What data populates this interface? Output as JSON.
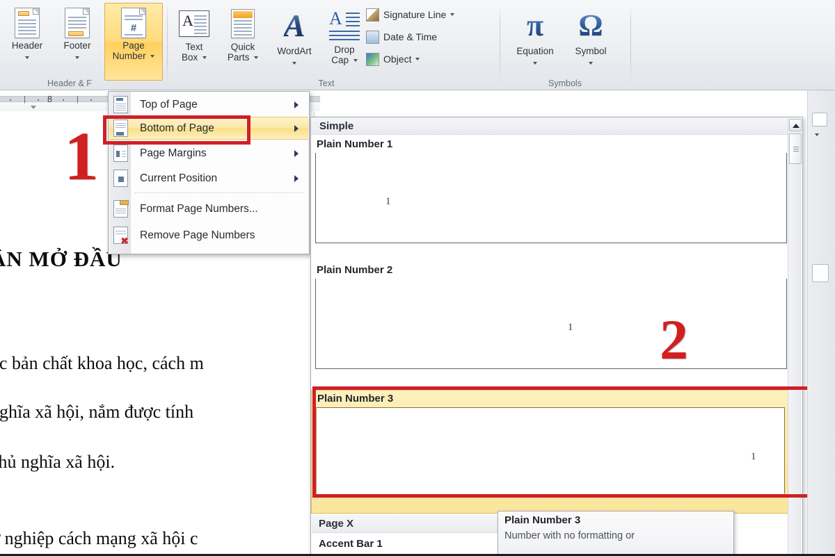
{
  "app": {
    "product": "Microsoft Word 2010",
    "context": "Insert ribbon tab — Page Number dropdown open with Bottom of Page gallery"
  },
  "ribbon": {
    "groups": [
      {
        "name": "Header & Footer",
        "label": "Header & F"
      },
      {
        "name": "Text",
        "label": "Text"
      },
      {
        "name": "Symbols",
        "label": "Symbols"
      }
    ],
    "buttons": [
      {
        "id": "header",
        "line1": "Header",
        "line2": "",
        "icon": "header-doc-icon",
        "has_caret": true,
        "active": false
      },
      {
        "id": "footer",
        "line1": "Footer",
        "line2": "",
        "icon": "footer-doc-icon",
        "has_caret": true,
        "active": false
      },
      {
        "id": "page_number",
        "line1": "Page",
        "line2": "Number",
        "icon": "page-number-doc-icon",
        "has_caret": true,
        "active": true
      },
      {
        "id": "text_box",
        "line1": "Text",
        "line2": "Box",
        "icon": "text-box-icon",
        "has_caret": true,
        "active": false
      },
      {
        "id": "quick_parts",
        "line1": "Quick",
        "line2": "Parts",
        "icon": "quick-parts-icon",
        "has_caret": true,
        "active": false
      },
      {
        "id": "wordart",
        "line1": "WordArt",
        "line2": "",
        "icon": "wordart-icon",
        "has_caret": true,
        "active": false
      },
      {
        "id": "drop_cap",
        "line1": "Drop",
        "line2": "Cap",
        "icon": "drop-cap-icon",
        "has_caret": true,
        "active": false
      },
      {
        "id": "equation",
        "line1": "Equation",
        "line2": "",
        "icon": "pi-icon",
        "glyph": "π",
        "has_caret": true,
        "active": false
      },
      {
        "id": "symbol",
        "line1": "Symbol",
        "line2": "",
        "icon": "omega-icon",
        "glyph": "Ω",
        "has_caret": true,
        "active": false
      }
    ],
    "small_commands": [
      {
        "id": "signature_line",
        "label": "Signature Line",
        "icon": "signature-line-icon",
        "has_caret": true
      },
      {
        "id": "date_time",
        "label": "Date & Time",
        "icon": "date-time-icon",
        "has_caret": false
      },
      {
        "id": "object",
        "label": "Object",
        "icon": "object-icon",
        "has_caret": true
      }
    ]
  },
  "menu": {
    "name": "page-number-menu",
    "items": [
      {
        "id": "top_of_page",
        "label": "Top of Page",
        "accel": "T",
        "submenu": true,
        "selected": false,
        "separator_after": false
      },
      {
        "id": "bottom_of_page",
        "label": "Bottom of Page",
        "accel": "B",
        "submenu": true,
        "selected": true,
        "separator_after": false
      },
      {
        "id": "page_margins",
        "label": "Page Margins",
        "accel": "P",
        "submenu": true,
        "selected": false,
        "separator_after": false
      },
      {
        "id": "current_position",
        "label": "Current Position",
        "accel": "C",
        "submenu": true,
        "selected": false,
        "separator_after": true
      },
      {
        "id": "format_page_numbers",
        "label": "Format Page Numbers...",
        "accel": "F",
        "submenu": false,
        "selected": false,
        "separator_after": false
      },
      {
        "id": "remove_page_numbers",
        "label": "Remove Page Numbers",
        "accel": "R",
        "submenu": false,
        "selected": false,
        "separator_after": false
      }
    ]
  },
  "gallery": {
    "name": "bottom-of-page-gallery",
    "section_header": "Simple",
    "items": [
      {
        "id": "plain_number_1",
        "label": "Plain Number 1",
        "preview_value": "1",
        "align": "left",
        "selected": false
      },
      {
        "id": "plain_number_2",
        "label": "Plain Number 2",
        "preview_value": "1",
        "align": "center",
        "selected": false
      },
      {
        "id": "plain_number_3",
        "label": "Plain Number 3",
        "preview_value": "1",
        "align": "right",
        "selected": true
      }
    ],
    "footer_section_header": "Page X",
    "footer_item": "Accent Bar 1",
    "scrollbar": {
      "up_arrow": "▲",
      "thumb_visible": true
    }
  },
  "tooltip": {
    "name": "gallery-tooltip",
    "title": "Plain Number 3",
    "description": "Number with no formatting or"
  },
  "document": {
    "ruler_label": "8",
    "heading": "ẦN MỞ ĐẦU",
    "lines": [
      "ọc bản chất khoa học, cách m",
      "nghĩa xã hội, nắm được tính",
      "chủ nghĩa xã hội.",
      "ự nghiệp cách mạng xã hội c"
    ]
  },
  "annotations": [
    {
      "id": "step-1",
      "text": "1",
      "color": "#d21f1f"
    },
    {
      "id": "step-2",
      "text": "2",
      "color": "#d21f1f"
    }
  ],
  "colors": {
    "highlight_gold": "#fbdf86",
    "annotation_red": "#cf2026",
    "ribbon_bg": "#eceef1",
    "menu_bg": "#fdfdfd"
  }
}
